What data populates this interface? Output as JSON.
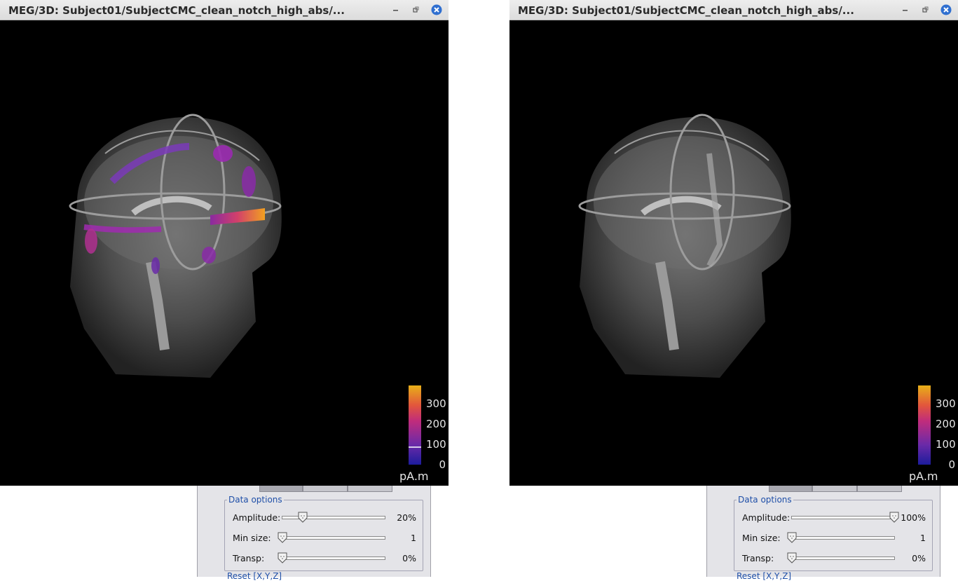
{
  "windows": [
    {
      "title": "MEG/3D: Subject01/SubjectCMC_clean_notch_high_abs/...",
      "colorbar": {
        "ticks": [
          "300",
          "200",
          "100",
          "0"
        ],
        "unit": "pA.m",
        "threshold_marker_value": 100
      },
      "overlay_visible": true
    },
    {
      "title": "MEG/3D: Subject01/SubjectCMC_clean_notch_high_abs/...",
      "colorbar": {
        "ticks": [
          "300",
          "200",
          "100",
          "0"
        ],
        "unit": "pA.m",
        "threshold_marker_value": null
      },
      "overlay_visible": false
    }
  ],
  "panels": [
    {
      "group_title": "Data options",
      "rows": [
        {
          "label": "Amplitude:",
          "value": "20%",
          "level": 0.2
        },
        {
          "label": "Min size:",
          "value": "1",
          "level": 0.0
        },
        {
          "label": "Transp:",
          "value": "0%",
          "level": 0.0
        }
      ],
      "reset_label": "Reset [X,Y,Z]"
    },
    {
      "group_title": "Data options",
      "rows": [
        {
          "label": "Amplitude:",
          "value": "100%",
          "level": 1.0
        },
        {
          "label": "Min size:",
          "value": "1",
          "level": 0.0
        },
        {
          "label": "Transp:",
          "value": "0%",
          "level": 0.0
        }
      ],
      "reset_label": "Reset [X,Y,Z]"
    }
  ],
  "colors": {
    "title_bar": "#e4e4e4",
    "close_button": "#2f6fd0",
    "panel_bg": "#e4e4e8",
    "group_title": "#1f4fa8",
    "colormap": [
      "#1c1c9c",
      "#6a2aa8",
      "#c02c7c",
      "#e2563c",
      "#e89a14",
      "#e8b018"
    ]
  },
  "icons": {
    "minimize": "minimize-icon",
    "restore": "restore-icon",
    "close": "close-icon",
    "slider_thumb": "slider-thumb-icon"
  }
}
